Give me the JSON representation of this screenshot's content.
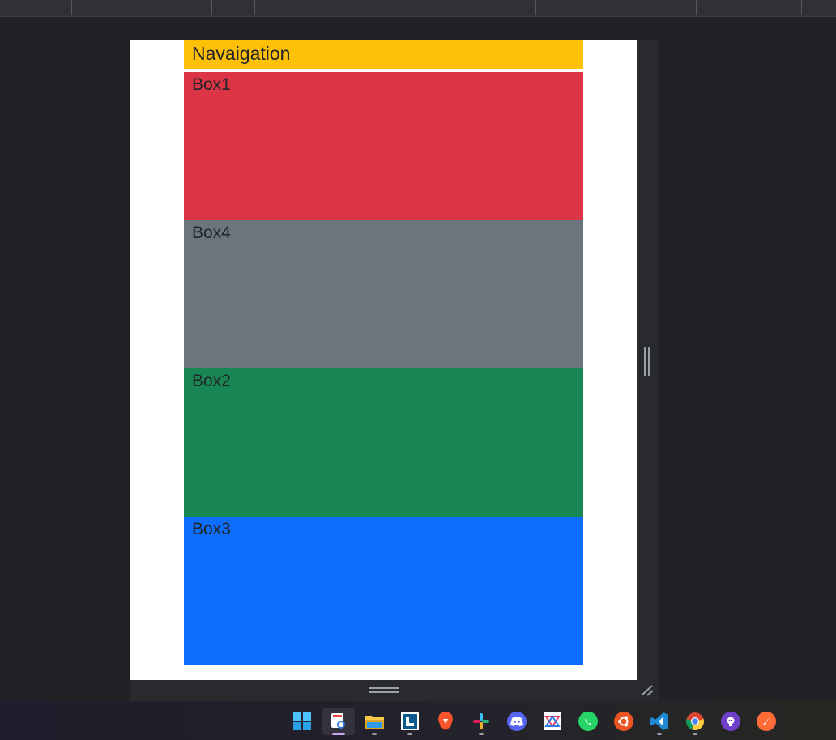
{
  "page": {
    "nav_label": "Navaigation",
    "boxes": [
      {
        "label": "Box1",
        "color": "#dc3545"
      },
      {
        "label": "Box4",
        "color": "#6c757d"
      },
      {
        "label": "Box2",
        "color": "#198754"
      },
      {
        "label": "Box3",
        "color": "#0d6efd"
      }
    ],
    "nav_color": "#ffc107"
  },
  "taskbar": {
    "apps": [
      {
        "name": "windows-start-icon",
        "active": false,
        "running": false
      },
      {
        "name": "snipping-tool-icon",
        "active": true,
        "running": true
      },
      {
        "name": "file-explorer-icon",
        "active": false,
        "running": true
      },
      {
        "name": "notes-app-icon",
        "active": false,
        "running": true
      },
      {
        "name": "brave-browser-icon",
        "active": false,
        "running": false
      },
      {
        "name": "slack-icon",
        "active": false,
        "running": true
      },
      {
        "name": "discord-icon",
        "active": false,
        "running": false
      },
      {
        "name": "paint-icon",
        "active": false,
        "running": false
      },
      {
        "name": "whatsapp-icon",
        "active": false,
        "running": false
      },
      {
        "name": "ubuntu-icon",
        "active": false,
        "running": false
      },
      {
        "name": "vscode-icon",
        "active": false,
        "running": true
      },
      {
        "name": "chrome-icon",
        "active": false,
        "running": true
      },
      {
        "name": "github-desktop-icon",
        "active": false,
        "running": false
      },
      {
        "name": "postman-icon",
        "active": false,
        "running": false
      }
    ]
  }
}
